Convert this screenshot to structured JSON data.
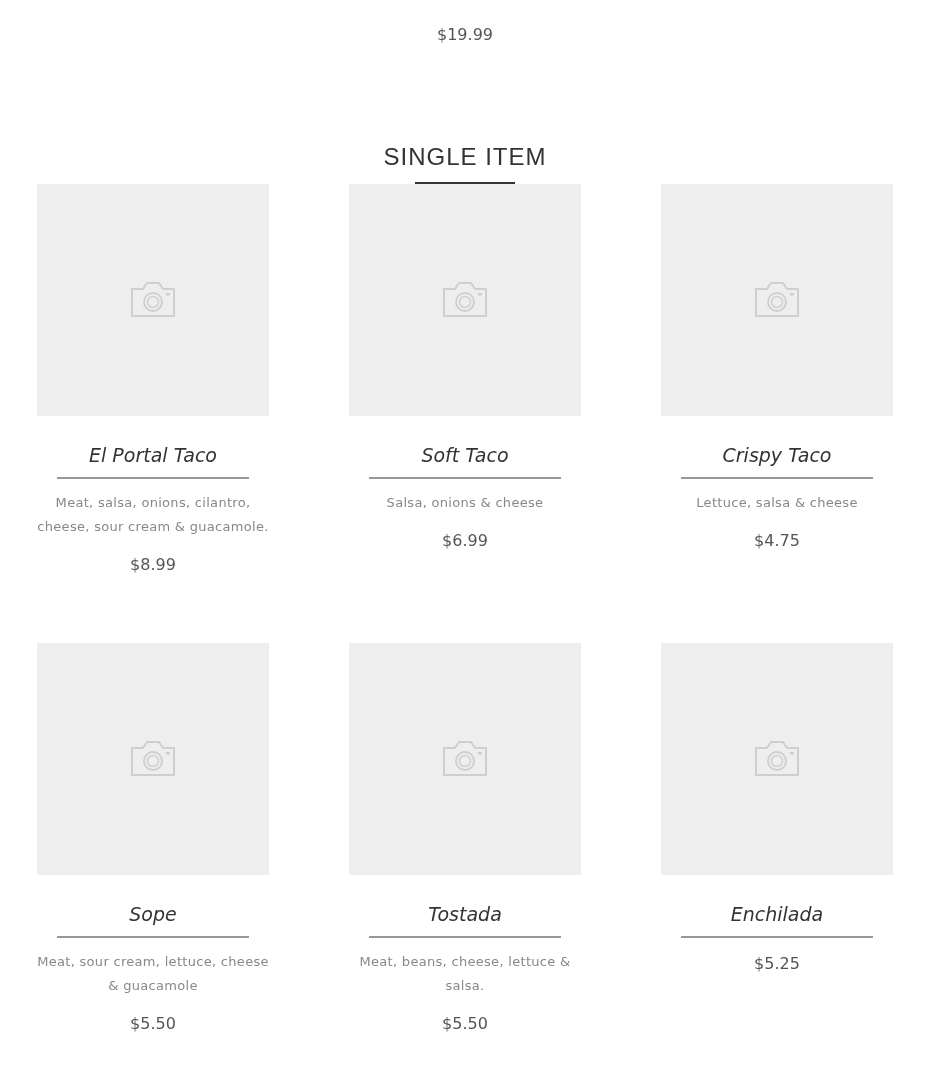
{
  "previous_item": {
    "price": "$19.99"
  },
  "section": {
    "title": "SINGLE ITEM"
  },
  "items": [
    {
      "name": "El Portal Taco",
      "description": "Meat, salsa, onions, cilantro, cheese, sour cream & guacamole.",
      "price": "$8.99"
    },
    {
      "name": "Soft Taco",
      "description": "Salsa, onions & cheese",
      "price": "$6.99"
    },
    {
      "name": "Crispy Taco",
      "description": "Lettuce, salsa & cheese",
      "price": "$4.75"
    },
    {
      "name": "Sope",
      "description": "Meat, sour cream, lettuce, cheese & guacamole",
      "price": "$5.50"
    },
    {
      "name": "Tostada",
      "description": "Meat, beans, cheese, lettuce & salsa.",
      "price": "$5.50"
    },
    {
      "name": "Enchilada",
      "price": "$5.25"
    }
  ]
}
